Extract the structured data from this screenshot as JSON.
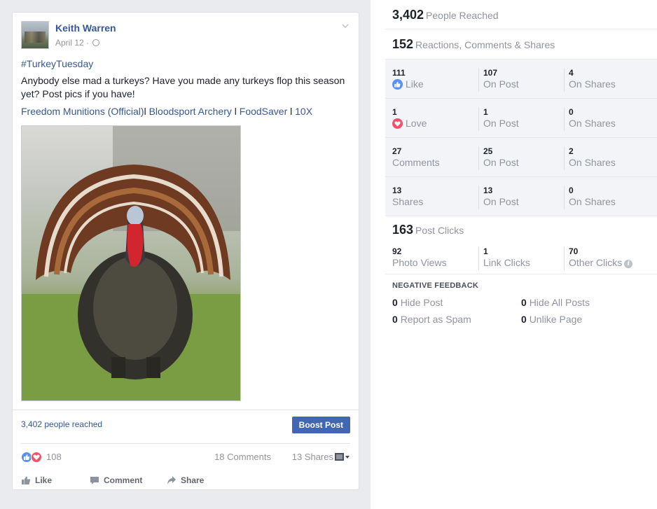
{
  "post": {
    "author": "Keith Warren",
    "date": "April 12 ·",
    "hashtag": "#TurkeyTuesday",
    "text": "Anybody else mad a turkeys? Have you made any turkeys flop this season yet? Post pics if you have!",
    "tags": [
      "Freedom Munitions (Official)",
      "Bloodsport Archery",
      "FoodSaver",
      "10X"
    ],
    "tag_separator": "l ",
    "people_reached": "3,402 people reached",
    "boost_label": "Boost Post",
    "reactions_count": "108",
    "comments": "18 Comments",
    "shares": "13 Shares",
    "actions": {
      "like": "Like",
      "comment": "Comment",
      "share": "Share"
    }
  },
  "stats": {
    "reached": {
      "value": "3,402",
      "label": "People Reached"
    },
    "engagement": {
      "value": "152",
      "label": "Reactions, Comments & Shares"
    },
    "rows": [
      {
        "total": "111",
        "label": "Like",
        "on_post": "107",
        "on_post_label": "On Post",
        "on_shares": "4",
        "on_shares_label": "On Shares"
      },
      {
        "total": "1",
        "label": "Love",
        "on_post": "1",
        "on_post_label": "On Post",
        "on_shares": "0",
        "on_shares_label": "On Shares"
      },
      {
        "total": "27",
        "label": "Comments",
        "on_post": "25",
        "on_post_label": "On Post",
        "on_shares": "2",
        "on_shares_label": "On Shares"
      },
      {
        "total": "13",
        "label": "Shares",
        "on_post": "13",
        "on_post_label": "On Post",
        "on_shares": "0",
        "on_shares_label": "On Shares"
      }
    ],
    "clicks": {
      "value": "163",
      "label": "Post Clicks"
    },
    "click_breakdown": [
      {
        "value": "92",
        "label": "Photo Views"
      },
      {
        "value": "1",
        "label": "Link Clicks"
      },
      {
        "value": "70",
        "label": "Other Clicks"
      }
    ],
    "negative_title": "NEGATIVE FEEDBACK",
    "negative": [
      {
        "value": "0",
        "label": "Hide Post"
      },
      {
        "value": "0",
        "label": "Hide All Posts"
      },
      {
        "value": "0",
        "label": "Report as Spam"
      },
      {
        "value": "0",
        "label": "Unlike Page"
      }
    ]
  },
  "colors": {
    "link": "#365899",
    "button": "#4267b2",
    "like": "#5890ff",
    "love": "#f25268"
  }
}
